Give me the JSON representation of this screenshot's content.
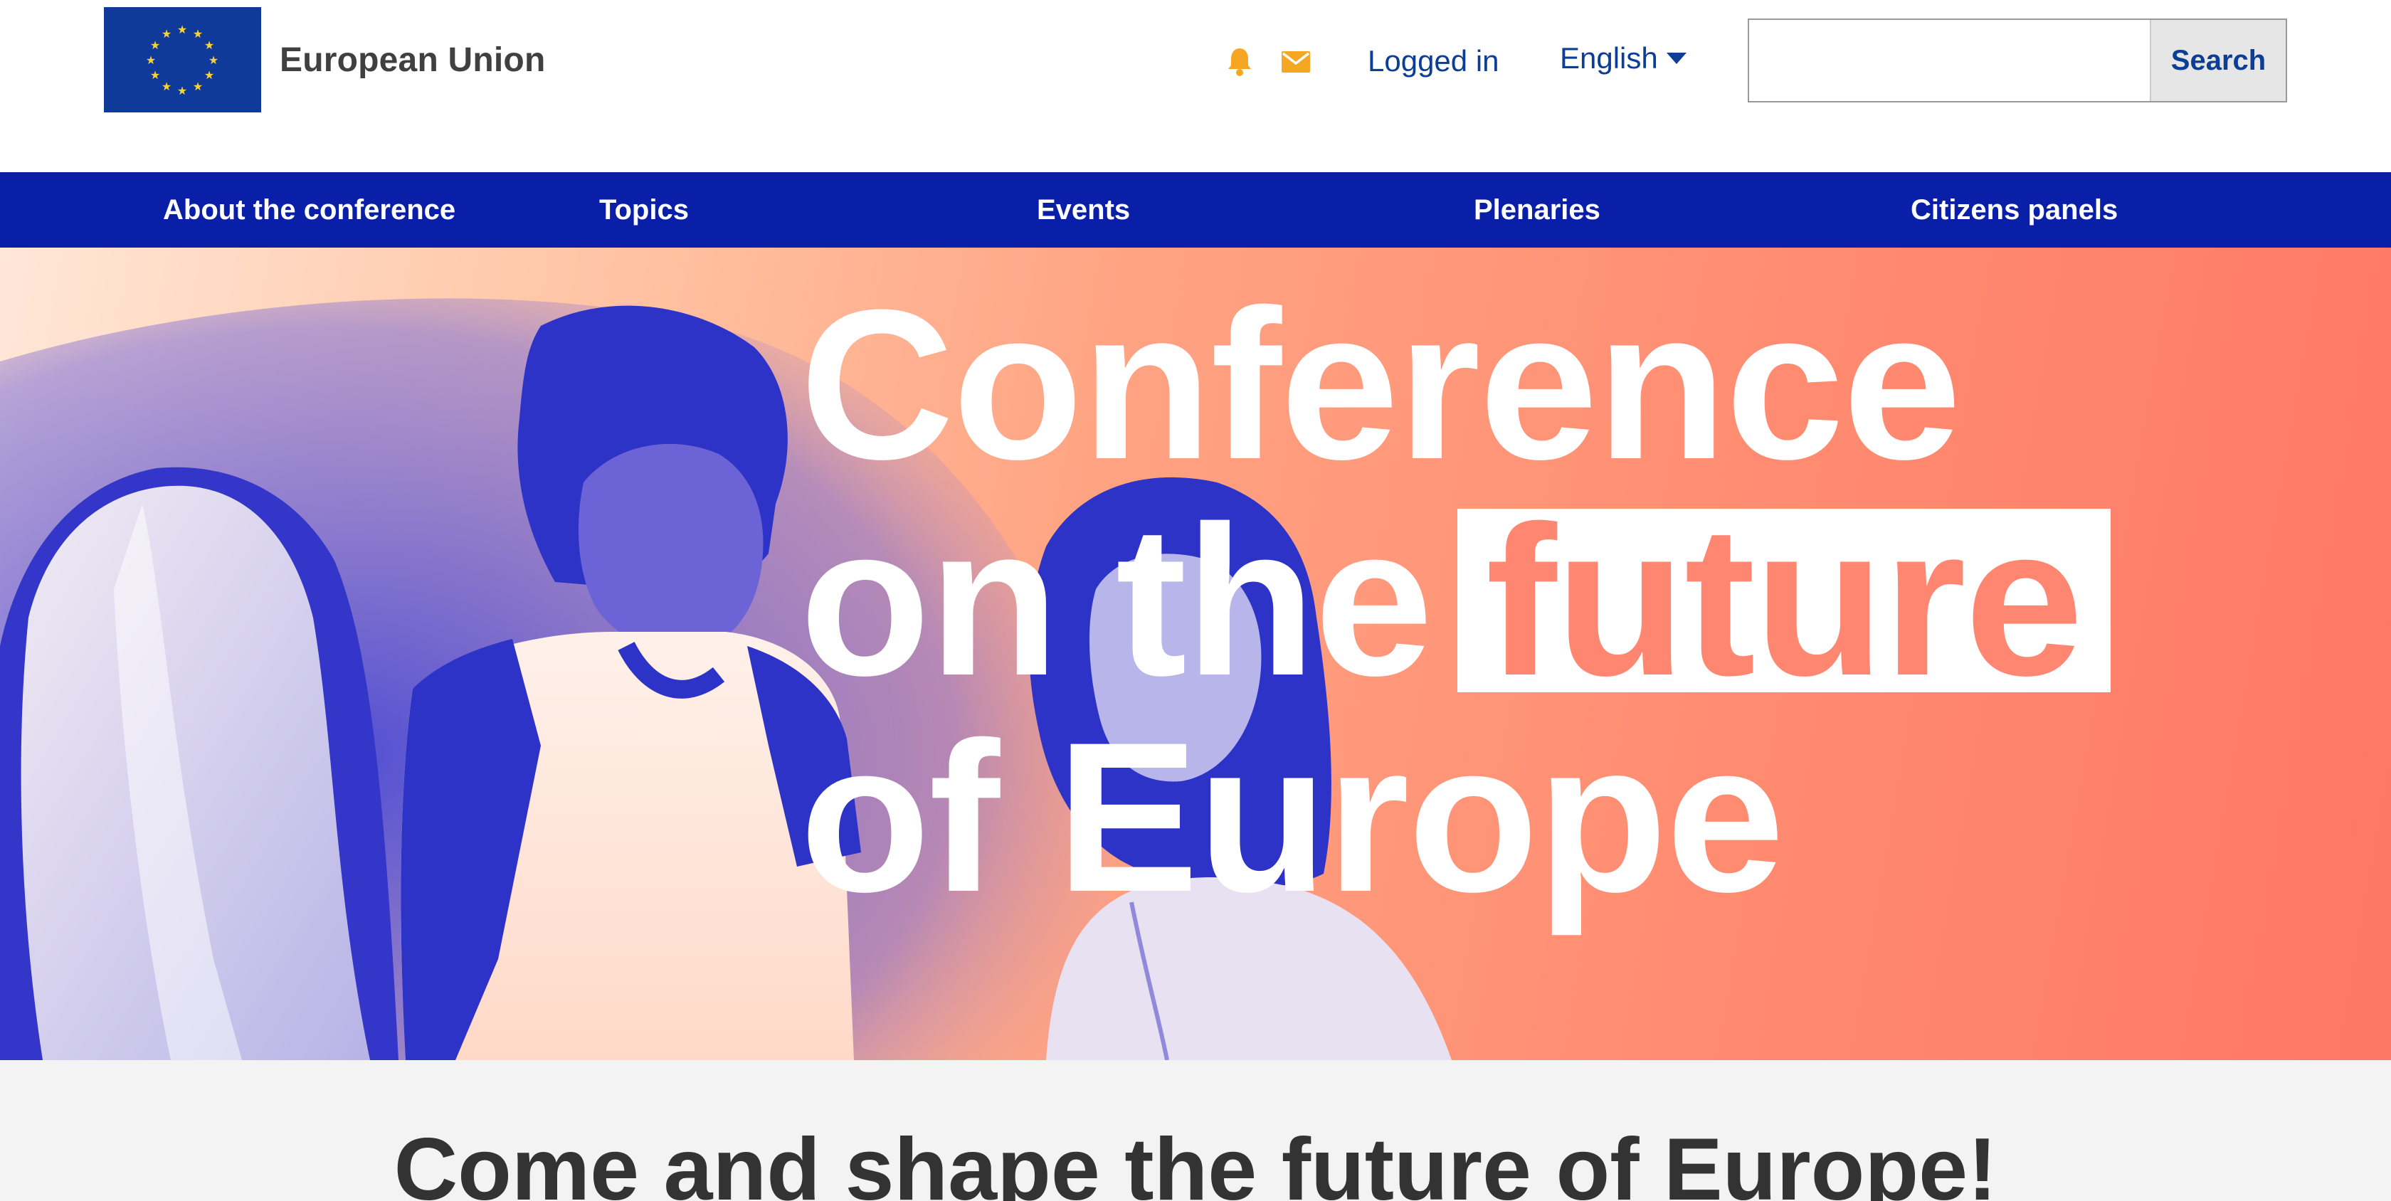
{
  "header": {
    "logo_text": "European Union",
    "flag_icon": "eu-flag-icon",
    "notification_icon": "bell-icon",
    "message_icon": "envelope-icon",
    "login_label": "Logged in",
    "language_label": "English",
    "language_icon": "caret-down-icon",
    "search_placeholder": "",
    "search_button_label": "Search"
  },
  "nav": {
    "items": [
      {
        "label": "About the conference"
      },
      {
        "label": "Topics"
      },
      {
        "label": "Events"
      },
      {
        "label": "Plenaries"
      },
      {
        "label": "Citizens panels"
      }
    ]
  },
  "hero": {
    "title_line1": "Conference",
    "title_line2_prefix": "on the",
    "title_line2_highlight": "future",
    "title_line3": "of Europe"
  },
  "main": {
    "heading": "Come and shape the future of Europe!"
  },
  "colors": {
    "nav_background": "#0a1fa8",
    "link_blue": "#0b3e94",
    "icon_orange": "#f5a623",
    "hero_coral": "#ff7765",
    "hero_photo_blue": "#2c36c9"
  }
}
